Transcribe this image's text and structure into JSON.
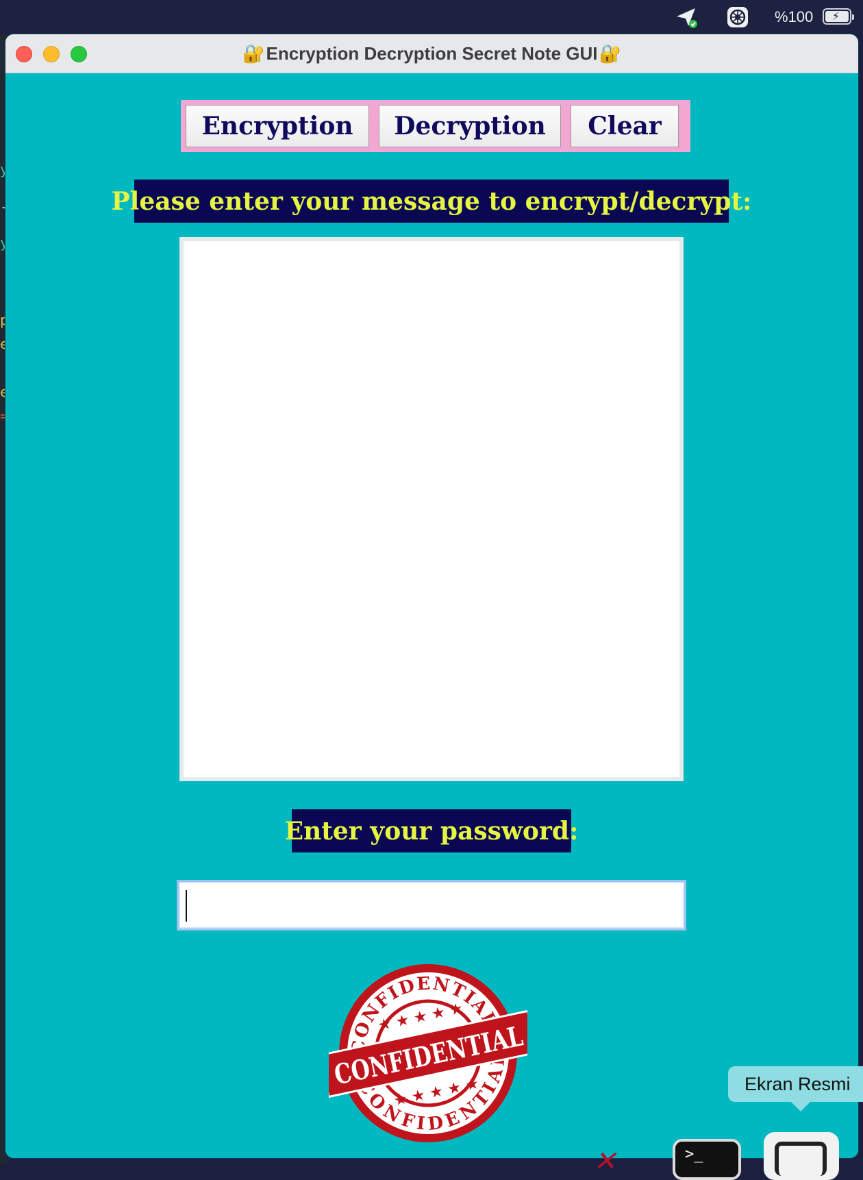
{
  "menubar": {
    "battery_text": "%100",
    "icons": [
      "paper-plane-icon",
      "settings-wheel-icon",
      "battery-charging-icon"
    ]
  },
  "window": {
    "title": "Encryption Decryption Secret Note GUI",
    "title_icon": "lock-with-key-icon"
  },
  "buttons": {
    "encryption": "Encryption",
    "decryption": "Decryption",
    "clear": "Clear"
  },
  "message_label": "Please enter your message to encrypt/decrypt:",
  "message_value": "",
  "password_label": "Enter your password:",
  "password_value": "",
  "stamp": {
    "text": "CONFIDENTIAL",
    "color": "#c0141c"
  },
  "tooltip": "Ekran Resmi",
  "colors": {
    "window_bg": "#00b8c0",
    "label_bg": "#0a0853",
    "label_fg": "#e6f542",
    "button_text": "#0f0a5c",
    "button_frame": "#f1a7d2"
  }
}
